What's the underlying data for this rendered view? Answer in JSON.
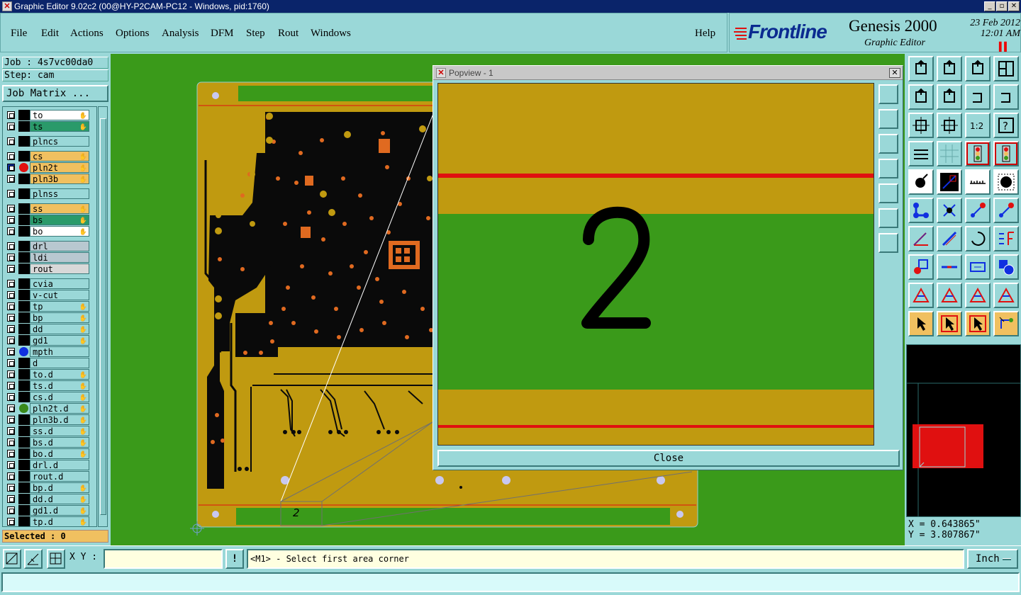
{
  "window": {
    "title": "Graphic Editor 9.02c2 (00@HY-P2CAM-PC12 - Windows, pid:1760)"
  },
  "menu": {
    "items": [
      {
        "label": "File"
      },
      {
        "label": "Edit"
      },
      {
        "label": "Actions"
      },
      {
        "label": "Options"
      },
      {
        "label": "Analysis"
      },
      {
        "label": "DFM"
      },
      {
        "label": "Step"
      },
      {
        "label": "Rout"
      },
      {
        "label": "Windows"
      }
    ],
    "help": "Help"
  },
  "brand": {
    "logo": "Frontline",
    "product": "Genesis 2000",
    "subtitle": "Graphic Editor",
    "date": "23 Feb 2012",
    "time": "12:01 AM"
  },
  "left": {
    "job": "Job : 4s7vc00da0",
    "step": "Step: cam",
    "job_matrix": "Job Matrix ...",
    "selected": "Selected : 0",
    "layers": [
      {
        "name": "to",
        "color": "#ffffff",
        "hand": true,
        "dot": null
      },
      {
        "name": "ts",
        "color": "#2a9a6a",
        "hand": true,
        "dot": null
      },
      {
        "name": "plncs",
        "color": "#9ad8d8",
        "hand": false,
        "dot": null,
        "gap": true
      },
      {
        "name": "cs",
        "color": "#f0c060",
        "hand": true,
        "dot": null,
        "gap": true
      },
      {
        "name": "pln2t",
        "color": "#f0c060",
        "hand": true,
        "dot": "#e01010",
        "active": true
      },
      {
        "name": "pln3b",
        "color": "#f0c060",
        "hand": true,
        "dot": null
      },
      {
        "name": "plnss",
        "color": "#9ad8d8",
        "hand": false,
        "dot": null,
        "gap": true
      },
      {
        "name": "ss",
        "color": "#f0c060",
        "hand": true,
        "dot": null,
        "gap": true
      },
      {
        "name": "bs",
        "color": "#2a9a6a",
        "hand": true,
        "dot": null
      },
      {
        "name": "bo",
        "color": "#ffffff",
        "hand": true,
        "dot": null
      },
      {
        "name": "drl",
        "color": "#b8c8d0",
        "hand": false,
        "dot": null,
        "gap": true
      },
      {
        "name": "ldi",
        "color": "#b8c8d0",
        "hand": false,
        "dot": null
      },
      {
        "name": "rout",
        "color": "#d8d8d8",
        "hand": false,
        "dot": null
      },
      {
        "name": "cvia",
        "color": "#9ad8d8",
        "hand": false,
        "dot": null,
        "gap": true
      },
      {
        "name": "v-cut",
        "color": "#9ad8d8",
        "hand": false,
        "dot": null
      },
      {
        "name": "tp",
        "color": "#9ad8d8",
        "hand": true,
        "dot": null
      },
      {
        "name": "bp",
        "color": "#9ad8d8",
        "hand": true,
        "dot": null
      },
      {
        "name": "dd",
        "color": "#9ad8d8",
        "hand": true,
        "dot": null
      },
      {
        "name": "gd1",
        "color": "#9ad8d8",
        "hand": true,
        "dot": null
      },
      {
        "name": "mpth",
        "color": "#9ad8d8",
        "hand": false,
        "dot": "#1030e0"
      },
      {
        "name": "d",
        "color": "#9ad8d8",
        "hand": false,
        "dot": null
      },
      {
        "name": "to.d",
        "color": "#9ad8d8",
        "hand": true,
        "dot": null
      },
      {
        "name": "ts.d",
        "color": "#9ad8d8",
        "hand": true,
        "dot": null
      },
      {
        "name": "cs.d",
        "color": "#9ad8d8",
        "hand": true,
        "dot": null
      },
      {
        "name": "pln2t.d",
        "color": "#9ad8d8",
        "hand": true,
        "dot": "#3a8a1a"
      },
      {
        "name": "pln3b.d",
        "color": "#9ad8d8",
        "hand": true,
        "dot": null
      },
      {
        "name": "ss.d",
        "color": "#9ad8d8",
        "hand": true,
        "dot": null
      },
      {
        "name": "bs.d",
        "color": "#9ad8d8",
        "hand": true,
        "dot": null
      },
      {
        "name": "bo.d",
        "color": "#9ad8d8",
        "hand": true,
        "dot": null
      },
      {
        "name": "drl.d",
        "color": "#9ad8d8",
        "hand": false,
        "dot": null
      },
      {
        "name": "rout.d",
        "color": "#9ad8d8",
        "hand": false,
        "dot": null
      },
      {
        "name": "bp.d",
        "color": "#9ad8d8",
        "hand": true,
        "dot": null
      },
      {
        "name": "dd.d",
        "color": "#9ad8d8",
        "hand": true,
        "dot": null
      },
      {
        "name": "gd1.d",
        "color": "#9ad8d8",
        "hand": true,
        "dot": null
      },
      {
        "name": "tp.d",
        "color": "#9ad8d8",
        "hand": true,
        "dot": null
      }
    ]
  },
  "popview": {
    "title": "Popview - 1",
    "digit": "2",
    "close_label": "Close"
  },
  "canvas": {
    "board_label": "2"
  },
  "coords": {
    "x": "X = 0.643865\"",
    "y": "Y = 3.807867\""
  },
  "bottom": {
    "xy_label": "X Y :",
    "xy_value": "",
    "prompt": "<M1> - Select first area corner",
    "units": "Inch",
    "excl": "!"
  },
  "colors": {
    "accent": "#9ad8d8",
    "board": "#c09a10",
    "background": "#3a9a1a",
    "copper": "#000000",
    "red_line": "#e01010"
  }
}
